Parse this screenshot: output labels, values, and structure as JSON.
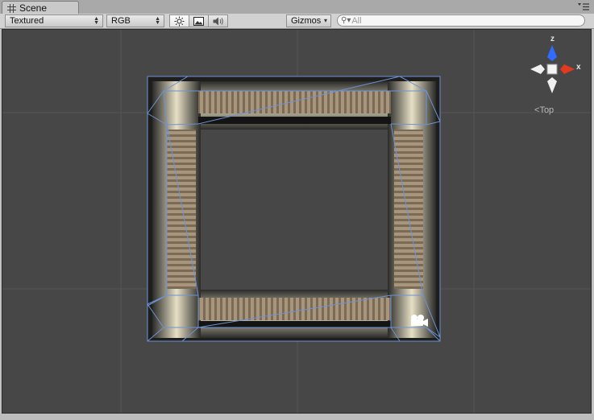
{
  "tab": {
    "title": "Scene",
    "icon": "grid-icon"
  },
  "toolbar": {
    "render_mode": "Textured",
    "channel_mode": "RGB",
    "gizmos_label": "Gizmos",
    "search_placeholder": "All"
  },
  "gizmo": {
    "axis_z": "z",
    "axis_x": "x",
    "view_label": "Top"
  },
  "colors": {
    "scene_bg": "#474747",
    "wire": "#5b86c8",
    "axis_z": "#2f6cff",
    "axis_x": "#e23a1f"
  }
}
